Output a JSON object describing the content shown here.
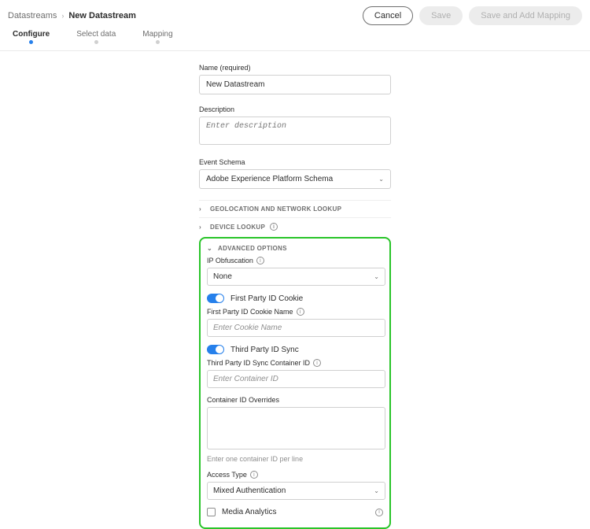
{
  "breadcrumb": {
    "root": "Datastreams",
    "current": "New Datastream"
  },
  "buttons": {
    "cancel": "Cancel",
    "save": "Save",
    "save_add": "Save and Add Mapping"
  },
  "tabs": [
    {
      "label": "Configure",
      "active": true
    },
    {
      "label": "Select data",
      "active": false
    },
    {
      "label": "Mapping",
      "active": false
    }
  ],
  "form": {
    "name_label": "Name (required)",
    "name_value": "New Datastream",
    "desc_label": "Description",
    "desc_placeholder": "Enter description",
    "schema_label": "Event Schema",
    "schema_value": "Adobe Experience Platform Schema"
  },
  "sections": {
    "geo": "GEOLOCATION AND NETWORK LOOKUP",
    "device": "DEVICE LOOKUP",
    "advanced": "ADVANCED OPTIONS"
  },
  "advanced": {
    "ip_obfuscation_label": "IP Obfuscation",
    "ip_obfuscation_value": "None",
    "first_party_toggle": "First Party ID Cookie",
    "first_party_name_label": "First Party ID Cookie Name",
    "first_party_name_placeholder": "Enter Cookie Name",
    "third_party_toggle": "Third Party ID Sync",
    "third_party_container_label": "Third Party ID Sync Container ID",
    "third_party_container_placeholder": "Enter Container ID",
    "overrides_label": "Container ID Overrides",
    "overrides_help": "Enter one container ID per line",
    "access_type_label": "Access Type",
    "access_type_value": "Mixed Authentication",
    "media_analytics_label": "Media Analytics"
  }
}
